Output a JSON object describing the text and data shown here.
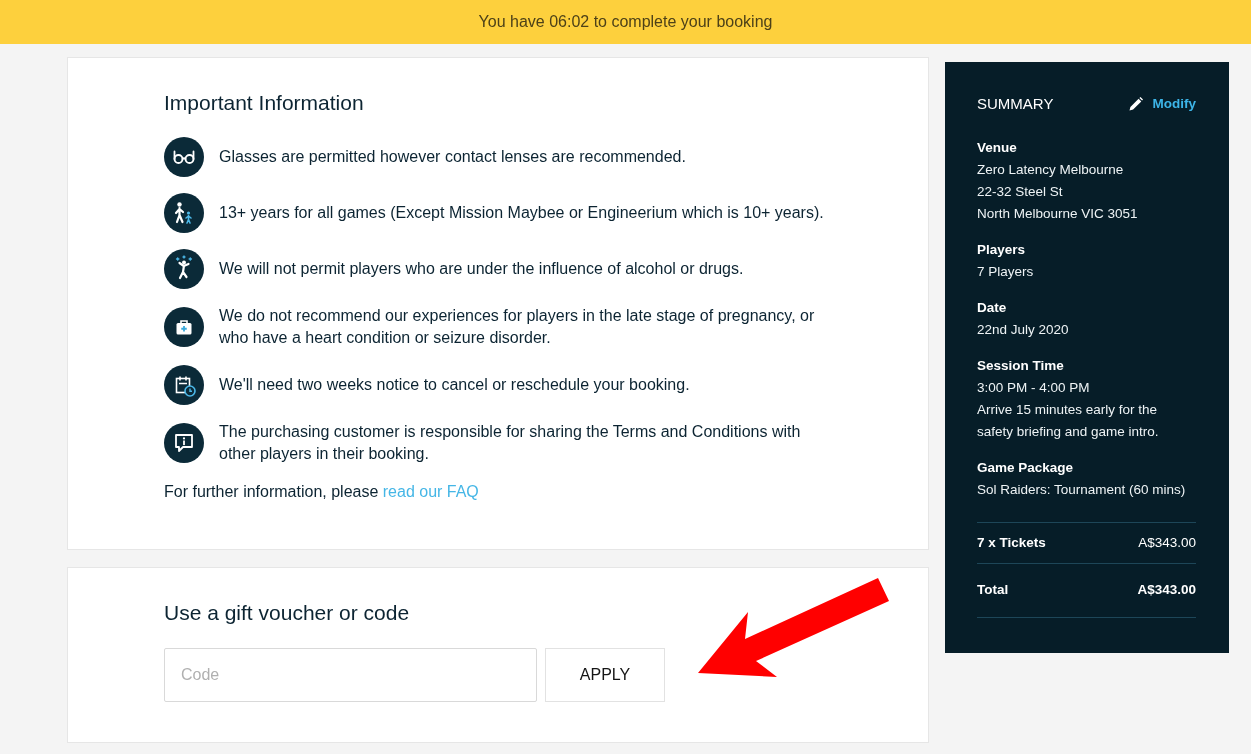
{
  "booking_timer": {
    "message": "You have 06:02 to complete your booking"
  },
  "important_information": {
    "title": "Important Information",
    "items": [
      "Glasses are permitted however contact lenses are recommended.",
      "13+ years for all games (Except Mission Maybee or Engineerium which is 10+ years).",
      "We will not permit players who are under the influence of alcohol or drugs.",
      "We do not recommend our experiences for players in the late stage of pregnancy, or who have a heart condition or seizure disorder.",
      "We'll need two weeks notice to cancel or reschedule your booking.",
      "The purchasing customer is responsible for sharing the Terms and Conditions with other players in their booking."
    ],
    "further_info": {
      "text": "For further information, please",
      "link": "read our FAQ"
    }
  },
  "voucher": {
    "title": "Use a gift voucher or code",
    "code_field": {
      "placeholder": "Code"
    },
    "apply_button": "APPLY"
  },
  "summary": {
    "title": "SUMMARY",
    "modify_link": "Modify",
    "sections": [
      {
        "label": "Venue",
        "lines": [
          "Zero Latency Melbourne",
          "22-32 Steel St",
          "North Melbourne VIC 3051"
        ]
      },
      {
        "label": "Players",
        "lines": [
          "7 Players"
        ]
      },
      {
        "label": "Date",
        "lines": [
          "22nd July 2020"
        ]
      },
      {
        "label": "Session Time",
        "lines": [
          "3:00 PM - 4:00 PM",
          "Arrive 15 minutes early for the safety briefing and game intro."
        ]
      },
      {
        "label": "Game Package",
        "lines": [
          "Sol Raiders: Tournament (60 mins)"
        ]
      }
    ],
    "totals": [
      {
        "kind": "subtotal",
        "label": "7 x Tickets",
        "amount": "A$343.00"
      },
      {
        "kind": "total",
        "label": "Total",
        "amount": "A$343.00"
      }
    ]
  }
}
